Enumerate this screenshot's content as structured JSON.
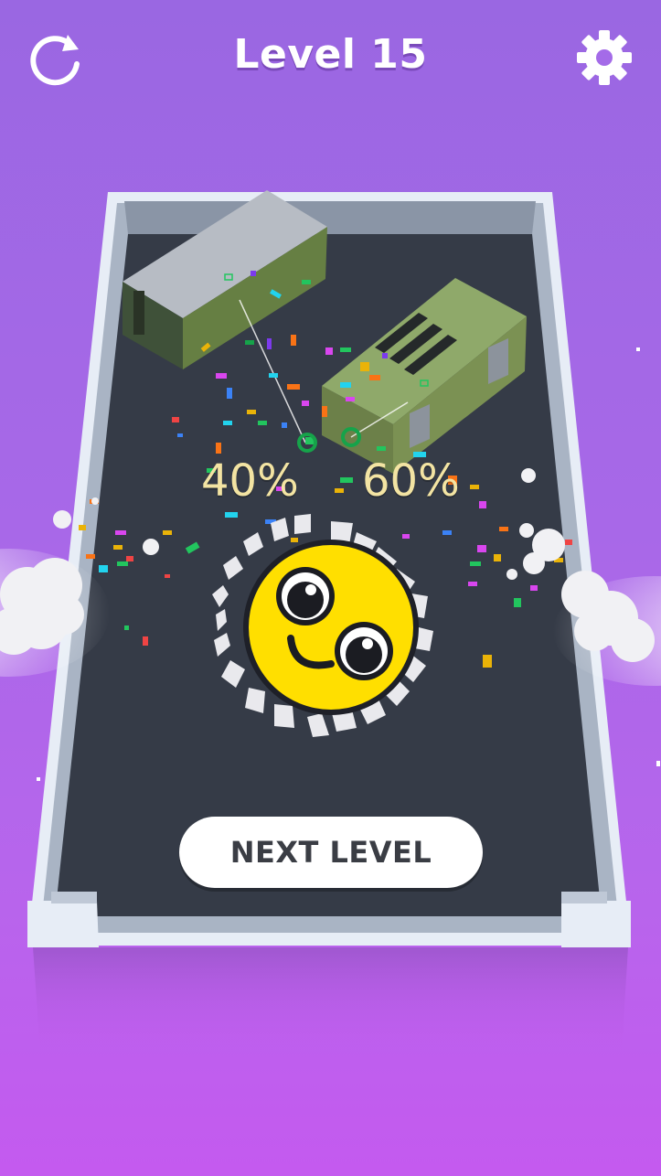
{
  "hud": {
    "level_title": "Level 15",
    "restart_icon": "restart-icon",
    "settings_icon": "gear-icon"
  },
  "result": {
    "left_percent": "40%",
    "right_percent": "60%"
  },
  "next_button": {
    "label": "NEXT LEVEL"
  },
  "colors": {
    "background_top": "#9a67e2",
    "background_bottom": "#c45aef",
    "floor": "#353b47",
    "wall": "#d8e2f0",
    "crate_green": "#8fa96a",
    "crate_gray": "#b9bdc4",
    "face_yellow": "#ffe000",
    "percent_text": "#f3e4a3"
  }
}
